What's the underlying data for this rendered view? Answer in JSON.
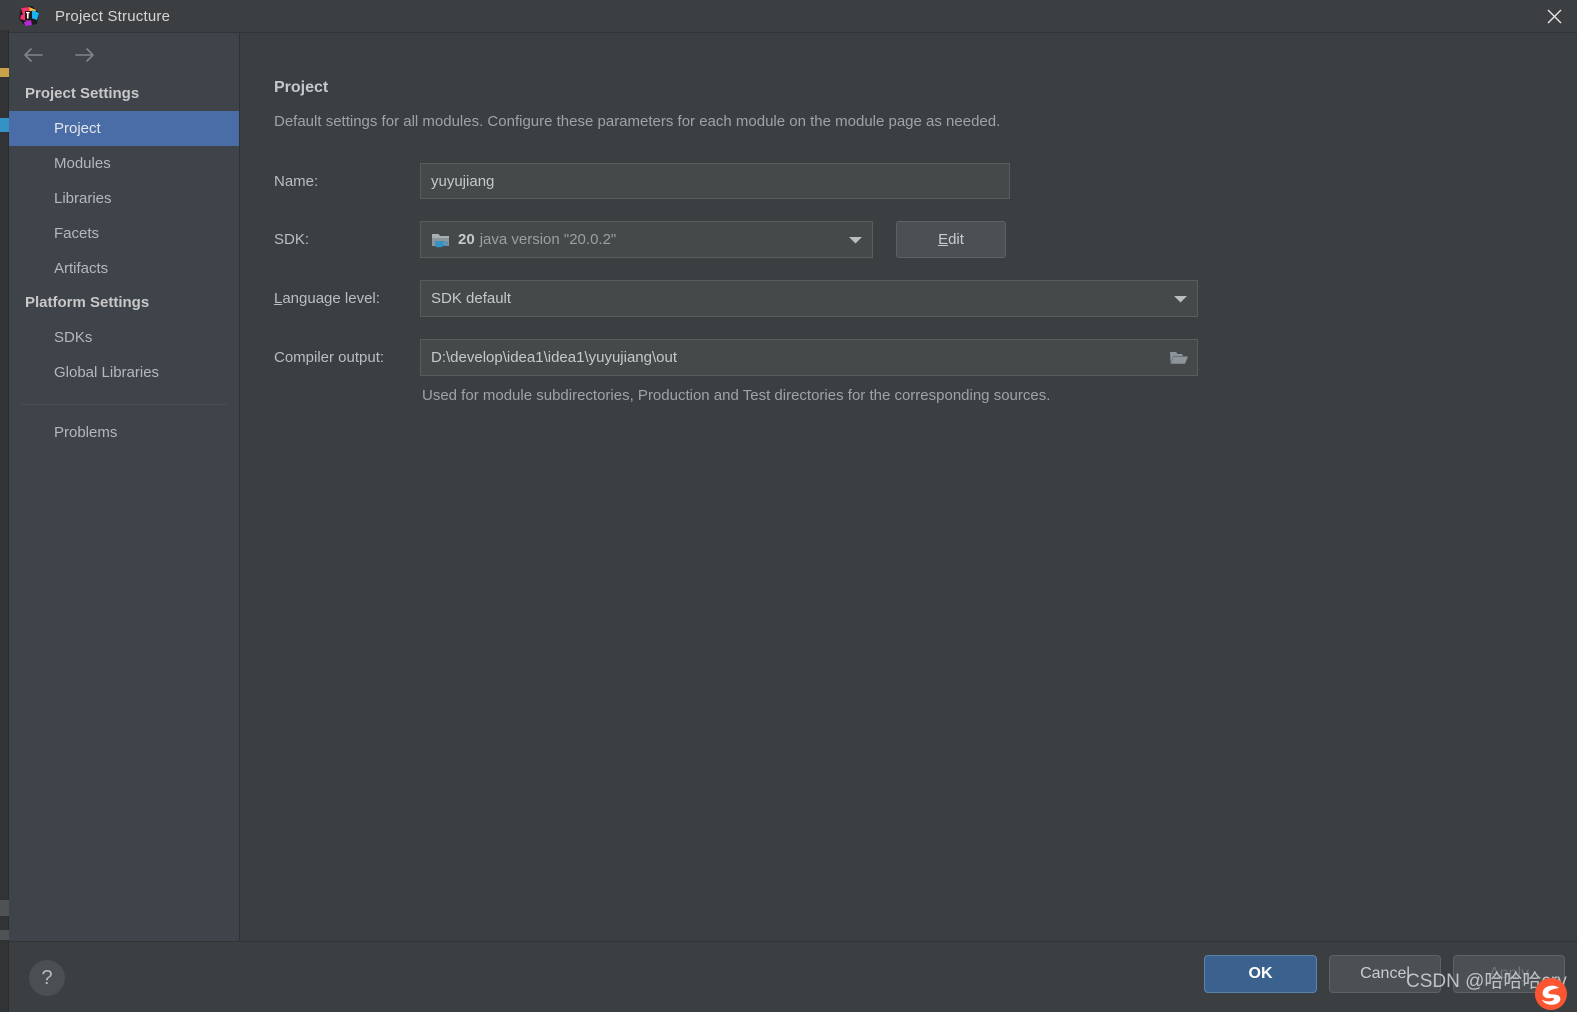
{
  "window": {
    "title": "Project Structure",
    "app_icon": "intellij-idea-icon",
    "close_icon": "close-icon"
  },
  "nav": {
    "back_icon": "arrow-left-icon",
    "forward_icon": "arrow-right-icon"
  },
  "sidebar": {
    "groups": [
      {
        "header": "Project Settings",
        "items": [
          {
            "label": "Project",
            "selected": true
          },
          {
            "label": "Modules",
            "selected": false
          },
          {
            "label": "Libraries",
            "selected": false
          },
          {
            "label": "Facets",
            "selected": false
          },
          {
            "label": "Artifacts",
            "selected": false
          }
        ]
      },
      {
        "header": "Platform Settings",
        "items": [
          {
            "label": "SDKs",
            "selected": false
          },
          {
            "label": "Global Libraries",
            "selected": false
          }
        ]
      }
    ],
    "extra_items": [
      {
        "label": "Problems",
        "selected": false
      }
    ]
  },
  "main": {
    "title": "Project",
    "description": "Default settings for all modules. Configure these parameters for each module on the module page as needed.",
    "fields": {
      "name": {
        "label": "Name:",
        "value": "yuyujiang",
        "placeholder": ""
      },
      "sdk": {
        "label": "SDK:",
        "icon": "java-sdk-folder-icon",
        "version": "20",
        "description": "java version \"20.0.2\"",
        "dropdown_icon": "chevron-down-icon",
        "edit_button": {
          "label": "Edit",
          "mnemonic": "E"
        }
      },
      "language_level": {
        "label": "Language level:",
        "mnemonic": "L",
        "value": "SDK default",
        "dropdown_icon": "chevron-down-icon"
      },
      "compiler_output": {
        "label": "Compiler output:",
        "value": "D:\\develop\\idea1\\idea1\\yuyujiang\\out",
        "browse_icon": "folder-open-icon",
        "hint": "Used for module subdirectories, Production and Test directories for the corresponding sources."
      }
    }
  },
  "footer": {
    "help_label": "?",
    "help_icon": "question-mark-icon",
    "buttons": [
      {
        "name": "ok",
        "label": "OK",
        "primary": true,
        "disabled": false
      },
      {
        "name": "cancel",
        "label": "Cancel",
        "primary": false,
        "disabled": false
      },
      {
        "name": "apply",
        "label": "Apply",
        "primary": false,
        "disabled": true
      }
    ]
  },
  "watermark": {
    "text": "CSDN @哈哈哈cry"
  },
  "colors": {
    "accent_selection": "#4a6da7",
    "primary_button": "#3b628f",
    "panel_bg": "#3c3f41",
    "sidebar_bg": "#3f434a",
    "input_bg": "#45494a",
    "text": "#c4c9cd",
    "muted_text": "#9ea3a8"
  }
}
